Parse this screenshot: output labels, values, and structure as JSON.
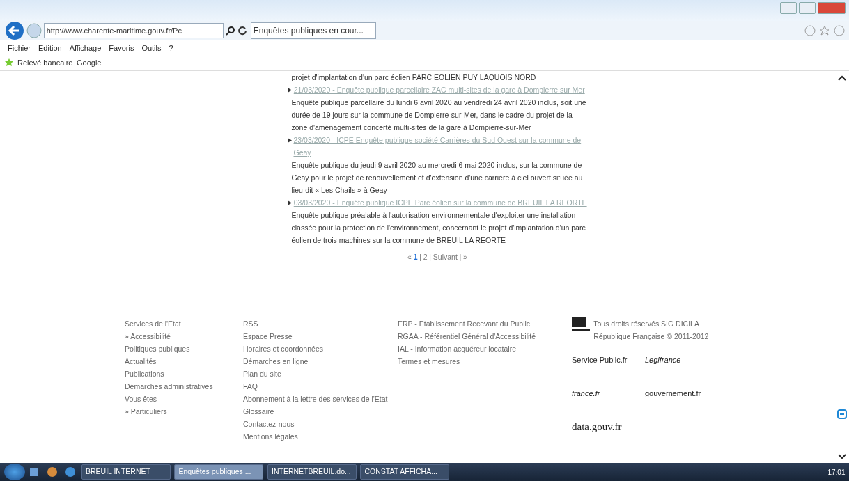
{
  "browser": {
    "url": "http://www.charente-maritime.gouv.fr/Pc",
    "tab_title": "Enquêtes publiques en cour...",
    "menu": [
      "Fichier",
      "Edition",
      "Affichage",
      "Favoris",
      "Outils",
      "?"
    ],
    "favorites": [
      "Relevé bancaire",
      "Google"
    ]
  },
  "content": {
    "items": [
      {
        "description": "projet d'implantation d'un parc éolien PARC EOLIEN PUY LAQUOIS NORD"
      },
      {
        "title": "21/03/2020 - Enquête publique parcellaire ZAC multi-sites de la gare à Dompierre sur Mer",
        "description": "Enquête publique parcellaire du lundi 6 avril 2020 au vendredi 24 avril 2020 inclus, soit une durée de 19 jours sur la commune de Dompierre-sur-Mer, dans le cadre du projet de la zone d'aménagement concerté multi-sites de la gare à Dompierre-sur-Mer"
      },
      {
        "title": "23/03/2020 - ICPE Enquête publique société Carrières du Sud Ouest sur la commune de Geay",
        "description": "Enquête publique du jeudi 9 avril 2020 au mercredi 6 mai 2020 inclus, sur la commune de Geay pour le projet de renouvellement et d'extension d'une carrière à ciel ouvert située au lieu-dit « Les Chails » à Geay"
      },
      {
        "title": "03/03/2020 - Enquête publique ICPE Parc éolien sur la commune de BREUIL LA REORTE",
        "description": "Enquête publique préalable à l'autorisation environnementale d'exploiter une installation classée pour la protection de l'environnement, concernant le projet d'implantation d'un parc éolien de trois machines sur la commune de BREUIL LA REORTE"
      }
    ],
    "pagination": [
      {
        "label": "«",
        "kind": "text"
      },
      {
        "label": "1",
        "kind": "page",
        "selected": true
      },
      {
        "label": "|",
        "kind": "text"
      },
      {
        "label": "2",
        "kind": "page",
        "selected": false
      },
      {
        "label": "|",
        "kind": "text"
      },
      {
        "label": "Suivant",
        "kind": "page",
        "selected": false
      },
      {
        "label": "|",
        "kind": "text"
      },
      {
        "label": "»",
        "kind": "text"
      }
    ]
  },
  "footer": {
    "columns": [
      [
        "Services de l'Etat",
        "» Accessibilité",
        "Politiques publiques",
        "Actualités",
        "Publications",
        "Démarches administratives",
        "Vous êtes",
        "» Particuliers"
      ],
      [
        "RSS",
        "Espace Presse",
        "Horaires et coordonnées",
        "Démarches en ligne",
        "Plan du site",
        "FAQ",
        "Abonnement à la lettre des services de l'Etat",
        "Glossaire",
        "Contactez-nous",
        "Mentions légales"
      ],
      [
        "ERP - Etablissement Recevant du Public",
        "RGAA - Référentiel Général d'Accessibilité",
        "IAL - Information acquéreur locataire",
        "Termes et mesures"
      ]
    ],
    "copyright": "Tous droits réservés SIG DICILA République Française © 2011-2012",
    "logos": [
      "Service Public.fr",
      "Legifrance",
      "france.fr",
      "gouvernement.fr",
      "data.gouv.fr"
    ]
  },
  "taskbar": {
    "buttons": [
      {
        "label": "BREUIL INTERNET",
        "selected": false
      },
      {
        "label": "Enquêtes publiques ...",
        "selected": true
      },
      {
        "label": "INTERNETBREUIL.do...",
        "selected": false
      },
      {
        "label": "CONSTAT AFFICHA...",
        "selected": false
      }
    ],
    "clock": "17:01"
  }
}
